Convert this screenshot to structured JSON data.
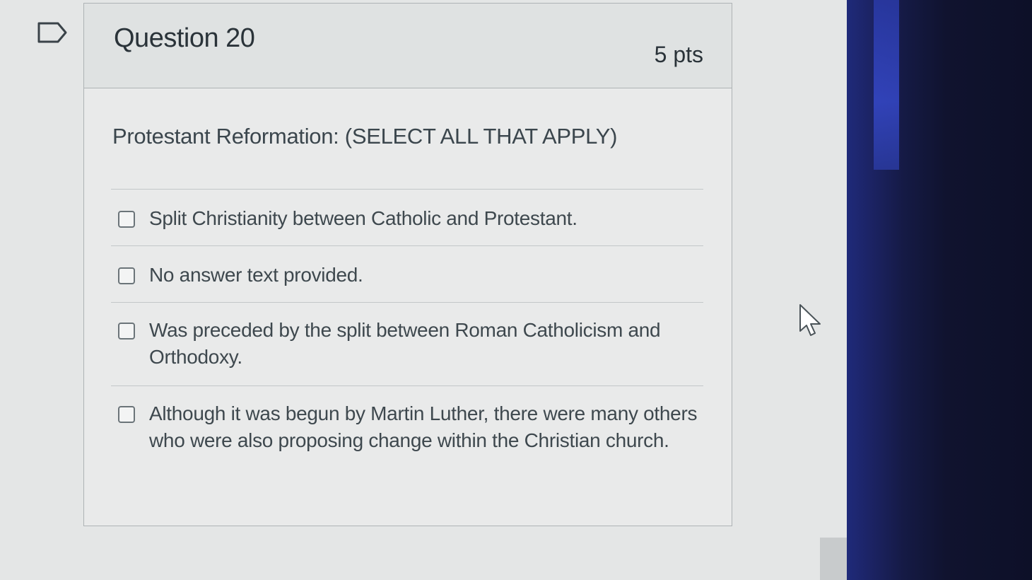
{
  "question": {
    "title": "Question 20",
    "points": "5 pts",
    "prompt": "Protestant Reformation: (SELECT ALL THAT APPLY)"
  },
  "answers": [
    {
      "label": "Split Christianity between Catholic and Protestant.",
      "checked": false
    },
    {
      "label": "No answer text provided.",
      "checked": false
    },
    {
      "label": "Was preceded by the split between Roman Catholicism and Orthodoxy.",
      "checked": false
    },
    {
      "label": "Although it was begun by Martin Luther, there were many others who were also proposing change within the Christian church.",
      "checked": false
    }
  ],
  "icons": {
    "flag": "flag-question-icon",
    "cursor": "mouse-pointer-icon"
  },
  "colors": {
    "page_background": "#e4e6e6",
    "card_border": "#aeb3b5",
    "text": "#2d3b45",
    "monitor_edge": "#1b2260"
  }
}
